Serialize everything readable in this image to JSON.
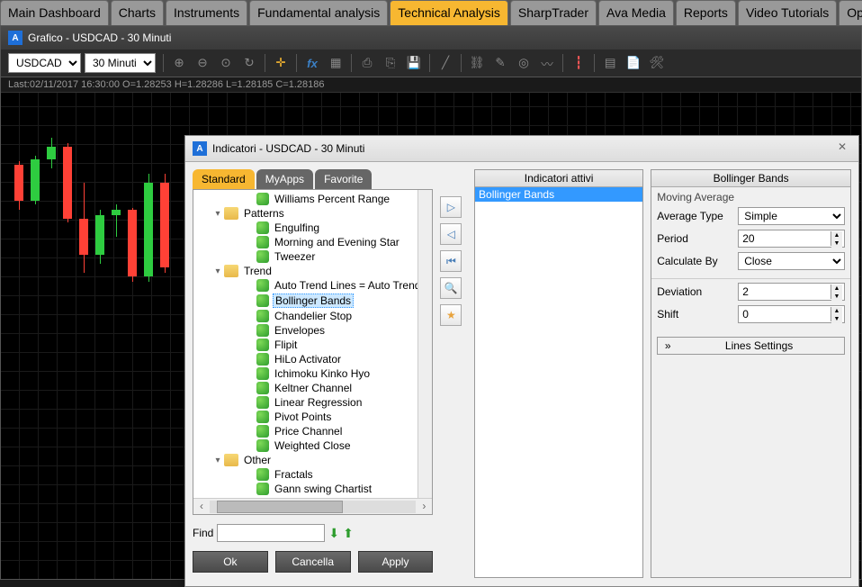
{
  "main_tabs": [
    "Main Dashboard",
    "Charts",
    "Instruments",
    "Fundamental analysis",
    "Technical Analysis",
    "SharpTrader",
    "Ava Media",
    "Reports",
    "Video Tutorials",
    "Op"
  ],
  "active_main_tab": "Technical Analysis",
  "chart_titlebar": "Grafico - USDCAD - 30 Minuti",
  "symbol_select": "USDCAD",
  "timeframe_select": "30 Minuti",
  "ohlc_text": "Last:02/11/2017 16:30:00 O=1.28253 H=1.28286 L=1.28185 C=1.28186",
  "modal": {
    "title": "Indicatori - USDCAD - 30 Minuti",
    "tabs": [
      "Standard",
      "MyApps",
      "Favorite"
    ],
    "active_tab": "Standard",
    "tree": {
      "head_item": "Williams Percent Range",
      "groups": [
        {
          "name": "Patterns",
          "items": [
            "Engulfing",
            "Morning and Evening Star",
            "Tweezer"
          ]
        },
        {
          "name": "Trend",
          "items": [
            "Auto Trend Lines = Auto Trend",
            "Bollinger Bands",
            "Chandelier Stop",
            "Envelopes",
            "Flipit",
            "HiLo Activator",
            "Ichimoku Kinko Hyo",
            "Keltner Channel",
            "Linear Regression",
            "Pivot Points",
            "Price Channel",
            "Weighted Close"
          ]
        },
        {
          "name": "Other",
          "items": [
            "Fractals",
            "Gann swing Chartist"
          ]
        }
      ],
      "selected": "Bollinger Bands"
    },
    "find_label": "Find",
    "buttons": {
      "ok": "Ok",
      "cancel": "Cancella",
      "apply": "Apply"
    },
    "active_header": "Indicatori attivi",
    "active_items": [
      "Bollinger Bands"
    ],
    "props": {
      "header": "Bollinger Bands",
      "group_title": "Moving Average",
      "rows": {
        "avg_type_label": "Average Type",
        "avg_type_value": "Simple",
        "period_label": "Period",
        "period_value": "20",
        "calc_label": "Calculate By",
        "calc_value": "Close",
        "deviation_label": "Deviation",
        "deviation_value": "2",
        "shift_label": "Shift",
        "shift_value": "0"
      },
      "lines_settings": "Lines Settings"
    }
  },
  "chart_data": {
    "type": "candlestick",
    "title": "USDCAD 30 Minuti",
    "ohlc": [
      {
        "o": 1.282,
        "h": 1.2822,
        "l": 1.2795,
        "c": 1.28
      },
      {
        "o": 1.28,
        "h": 1.2825,
        "l": 1.2798,
        "c": 1.2823
      },
      {
        "o": 1.2823,
        "h": 1.2835,
        "l": 1.2818,
        "c": 1.283
      },
      {
        "o": 1.283,
        "h": 1.2832,
        "l": 1.2788,
        "c": 1.279
      },
      {
        "o": 1.279,
        "h": 1.281,
        "l": 1.276,
        "c": 1.277
      },
      {
        "o": 1.277,
        "h": 1.2795,
        "l": 1.2765,
        "c": 1.2792
      },
      {
        "o": 1.2792,
        "h": 1.2798,
        "l": 1.278,
        "c": 1.2795
      },
      {
        "o": 1.2795,
        "h": 1.2796,
        "l": 1.2755,
        "c": 1.2758
      },
      {
        "o": 1.2758,
        "h": 1.2815,
        "l": 1.2755,
        "c": 1.281
      },
      {
        "o": 1.281,
        "h": 1.2815,
        "l": 1.276,
        "c": 1.2763
      }
    ],
    "y_range": [
      1.275,
      1.284
    ]
  }
}
